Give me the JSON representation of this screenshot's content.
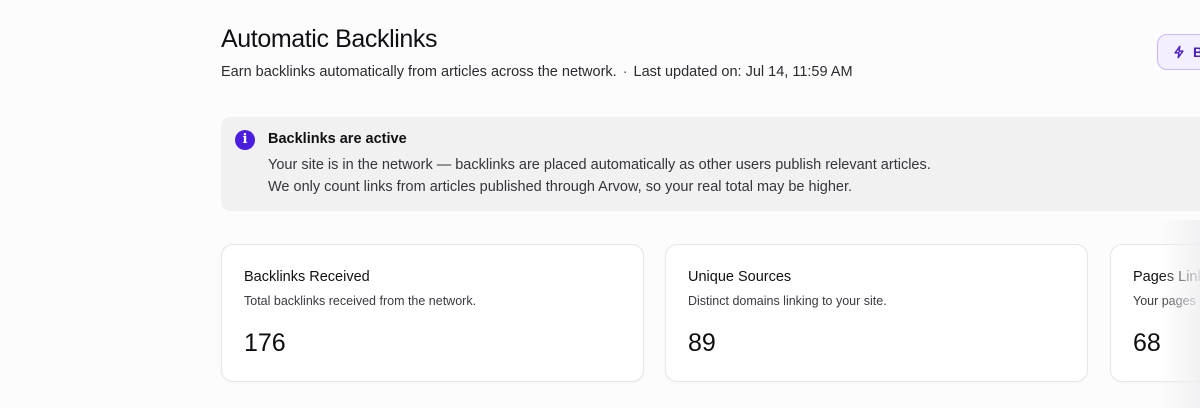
{
  "header": {
    "title": "Automatic Backlinks",
    "subtitle": "Earn backlinks automatically from articles across the network.",
    "separator": "·",
    "last_updated": "Last updated on: Jul 14, 11:59 AM",
    "action_button_label": "B",
    "action_button_icon": "lightning-icon"
  },
  "alert": {
    "icon": "info-icon",
    "icon_glyph": "i",
    "title": "Backlinks are active",
    "line1": "Your site is in the network — backlinks are placed automatically as other users publish relevant articles.",
    "line2": "We only count links from articles published through Arvow, so your real total may be higher."
  },
  "stats": [
    {
      "title": "Backlinks Received",
      "description": "Total backlinks received from the network.",
      "value": "176"
    },
    {
      "title": "Unique Sources",
      "description": "Distinct domains linking to your site.",
      "value": "89"
    },
    {
      "title": "Pages Linked",
      "description": "Your pages",
      "value": "68"
    }
  ],
  "colors": {
    "accent": "#4a1ee0",
    "button_bg": "#f4efff",
    "button_border": "#c9b8f2",
    "alert_bg": "#f1f1f2"
  }
}
